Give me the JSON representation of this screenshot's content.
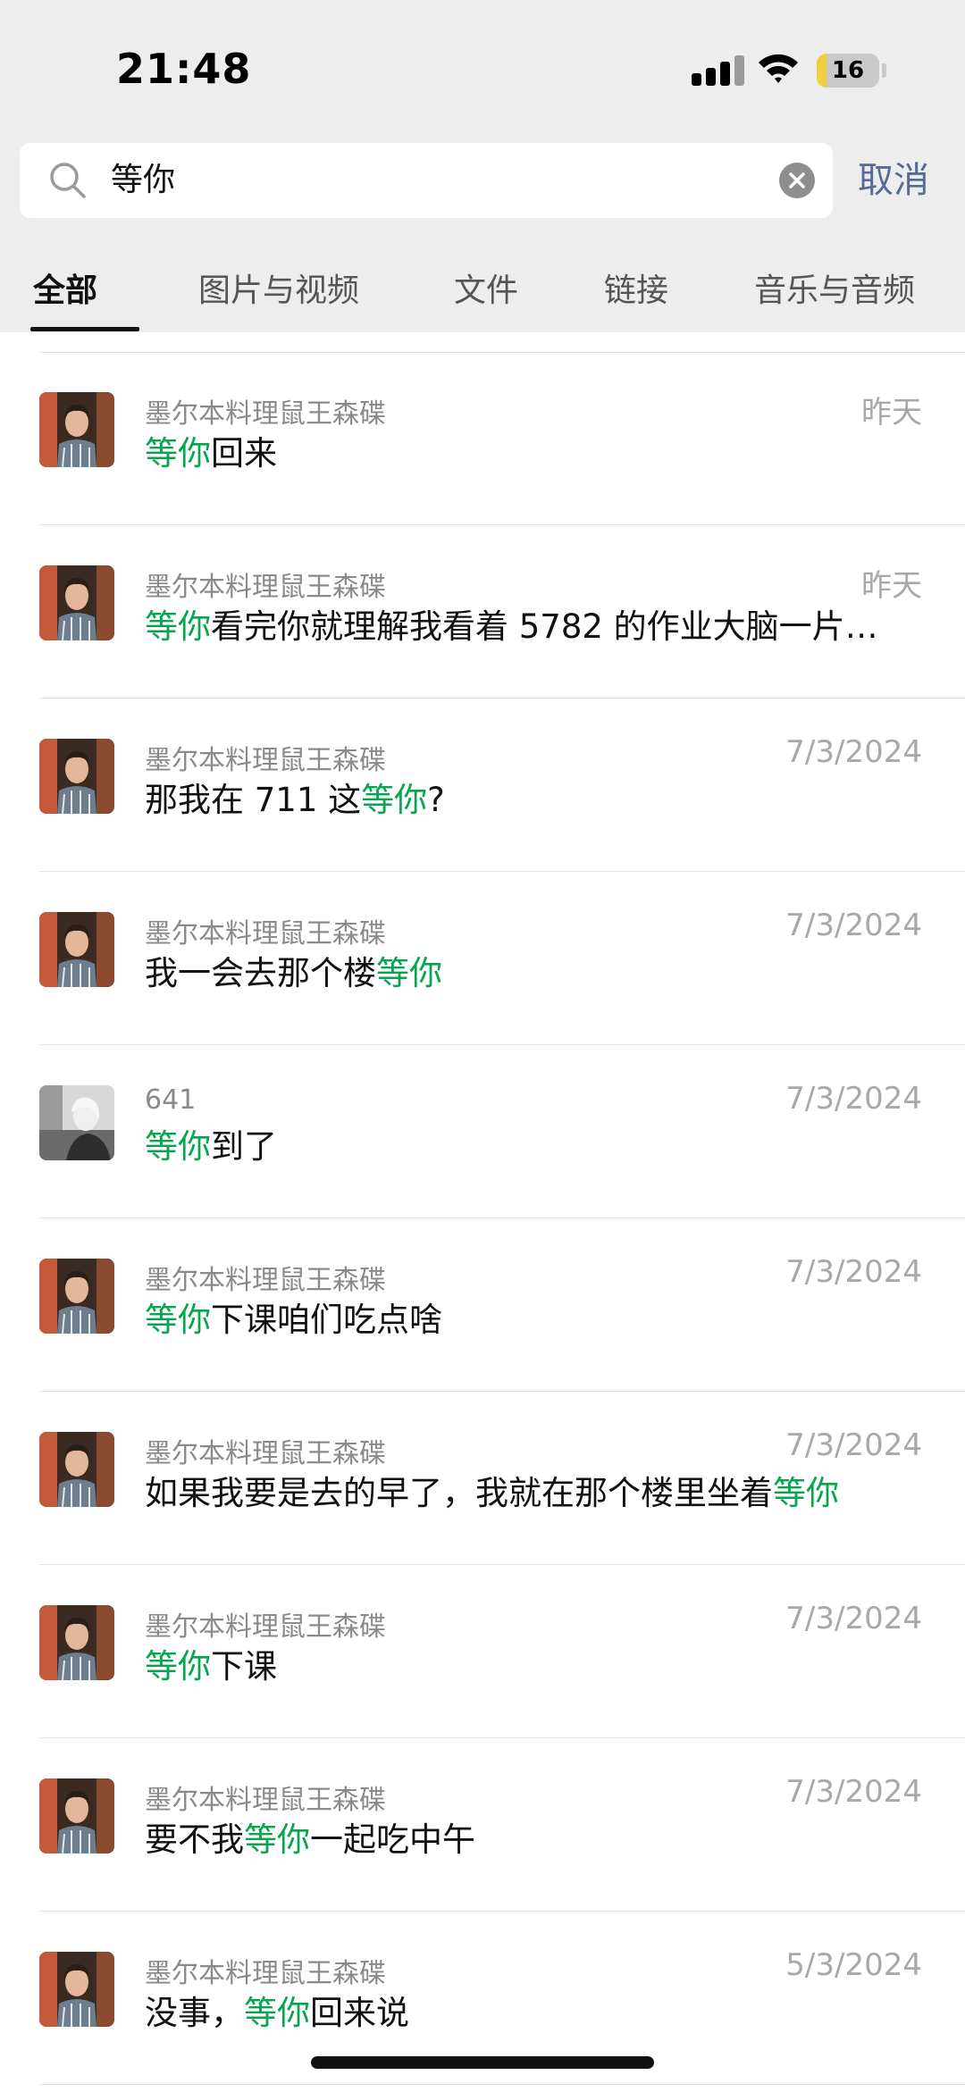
{
  "status_bar": {
    "time": "21:48",
    "battery_percent": "16",
    "battery_level": 0.16
  },
  "search": {
    "query": "等你",
    "cancel_label": "取消"
  },
  "tabs": [
    {
      "label": "全部",
      "active": true
    },
    {
      "label": "图片与视频",
      "active": false
    },
    {
      "label": "文件",
      "active": false
    },
    {
      "label": "链接",
      "active": false
    },
    {
      "label": "音乐与音频",
      "active": false
    }
  ],
  "results": [
    {
      "name": "墨尔本料理鼠王森碟",
      "date": "昨天",
      "pre": "",
      "hl": "等你",
      "post": "回来",
      "avatar": "person-a"
    },
    {
      "name": "墨尔本料理鼠王森碟",
      "date": "昨天",
      "pre": "",
      "hl": "等你",
      "post": "看完你就理解我看着 5782 的作业大脑一片…",
      "avatar": "person-a"
    },
    {
      "name": "墨尔本料理鼠王森碟",
      "date": "7/3/2024",
      "pre": "那我在 711 这",
      "hl": "等你",
      "post": "?",
      "avatar": "person-a"
    },
    {
      "name": "墨尔本料理鼠王森碟",
      "date": "7/3/2024",
      "pre": "我一会去那个楼",
      "hl": "等你",
      "post": "",
      "avatar": "person-a"
    },
    {
      "name": "641",
      "date": "7/3/2024",
      "pre": "",
      "hl": "等你",
      "post": "到了",
      "avatar": "person-b"
    },
    {
      "name": "墨尔本料理鼠王森碟",
      "date": "7/3/2024",
      "pre": "",
      "hl": "等你",
      "post": "下课咱们吃点啥",
      "avatar": "person-a"
    },
    {
      "name": "墨尔本料理鼠王森碟",
      "date": "7/3/2024",
      "pre": "如果我要是去的早了，我就在那个楼里坐着",
      "hl": "等你",
      "post": "",
      "avatar": "person-a"
    },
    {
      "name": "墨尔本料理鼠王森碟",
      "date": "7/3/2024",
      "pre": "",
      "hl": "等你",
      "post": "下课",
      "avatar": "person-a"
    },
    {
      "name": "墨尔本料理鼠王森碟",
      "date": "7/3/2024",
      "pre": "要不我",
      "hl": "等你",
      "post": "一起吃中午",
      "avatar": "person-a"
    },
    {
      "name": "墨尔本料理鼠王森碟",
      "date": "5/3/2024",
      "pre": "没事，",
      "hl": "等你",
      "post": "回来说",
      "avatar": "person-a"
    }
  ],
  "colors": {
    "highlight": "#07a54f",
    "link": "#576b95",
    "header_bg": "#ededed"
  }
}
